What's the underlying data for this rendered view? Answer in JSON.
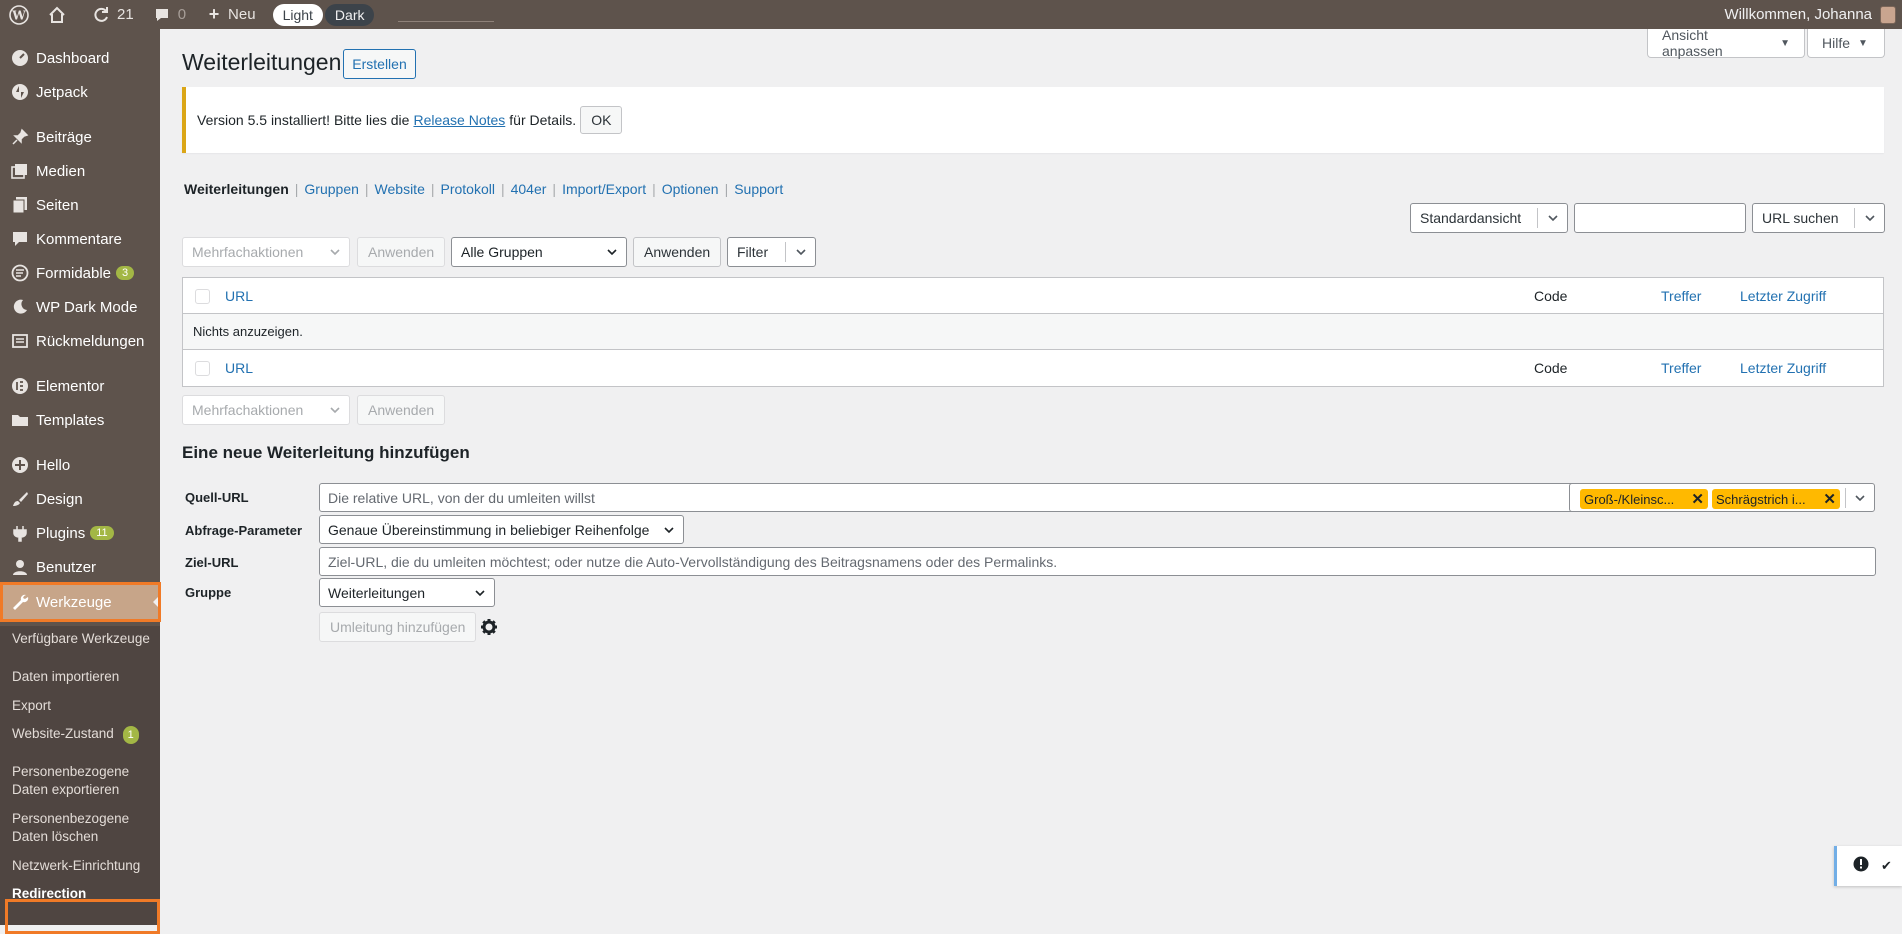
{
  "adminbar": {
    "updates_count": "21",
    "comments_count": "0",
    "new_label": "Neu",
    "mode_light": "Light",
    "mode_dark": "Dark",
    "greeting": "Willkommen, Johanna"
  },
  "sidebar": {
    "items": [
      {
        "label": "Dashboard",
        "icon": "dashboard-icon"
      },
      {
        "label": "Jetpack",
        "icon": "jetpack-icon"
      },
      {
        "label": "Beiträge",
        "icon": "pin-icon"
      },
      {
        "label": "Medien",
        "icon": "media-icon"
      },
      {
        "label": "Seiten",
        "icon": "pages-icon"
      },
      {
        "label": "Kommentare",
        "icon": "comment-icon"
      },
      {
        "label": "Formidable",
        "icon": "formidable-icon",
        "badge": "3"
      },
      {
        "label": "WP Dark Mode",
        "icon": "moon-icon"
      },
      {
        "label": "Rückmeldungen",
        "icon": "feedback-icon"
      },
      {
        "label": "Elementor",
        "icon": "elementor-icon"
      },
      {
        "label": "Templates",
        "icon": "folder-icon"
      },
      {
        "label": "Hello",
        "icon": "plus-circle-icon"
      },
      {
        "label": "Design",
        "icon": "brush-icon"
      },
      {
        "label": "Plugins",
        "icon": "plugin-icon",
        "badge": "11"
      },
      {
        "label": "Benutzer",
        "icon": "user-icon"
      },
      {
        "label": "Werkzeuge",
        "icon": "wrench-icon"
      }
    ],
    "submenu": [
      "Verfügbare Werkzeuge",
      "Daten importieren",
      "Export",
      "Website-Zustand",
      "Personenbezogene Daten exportieren",
      "Personenbezogene Daten löschen",
      "Netzwerk-Einrichtung",
      "Redirection"
    ],
    "website_badge": "1"
  },
  "header": {
    "screen_options": "Ansicht anpassen",
    "help": "Hilfe",
    "title": "Weiterleitungen",
    "create_button": "Erstellen"
  },
  "notice": {
    "text_before": "Version 5.5 installiert! Bitte lies die",
    "link": "Release Notes",
    "text_after": "für Details.",
    "ok": "OK"
  },
  "tabs": [
    "Weiterleitungen",
    "Gruppen",
    "Website",
    "Protokoll",
    "404er",
    "Import/Export",
    "Optionen",
    "Support"
  ],
  "controls": {
    "view_select": "Standardansicht",
    "search_value": "",
    "search_button": "URL suchen",
    "bulk_actions": "Mehrfachaktionen",
    "apply": "Anwenden",
    "groups_select": "Alle Gruppen",
    "apply2": "Anwenden",
    "filter": "Filter"
  },
  "table": {
    "columns": {
      "url": "URL",
      "code": "Code",
      "hits": "Treffer",
      "last": "Letzter Zugriff"
    },
    "empty": "Nichts anzuzeigen."
  },
  "add_form": {
    "title": "Eine neue Weiterleitung hinzufügen",
    "source_label": "Quell-URL",
    "source_placeholder": "Die relative URL, von der du umleiten willst",
    "flag1": "Groß-/Kleinsc...",
    "flag2": "Schrägstrich i...",
    "query_label": "Abfrage-Parameter",
    "query_value": "Genaue Übereinstimmung in beliebiger Reihenfolge",
    "target_label": "Ziel-URL",
    "target_placeholder": "Ziel-URL, die du umleiten möchtest; oder nutze die Auto-Vervollständigung des Beitragsnamens oder des Permalinks.",
    "group_label": "Gruppe",
    "group_value": "Weiterleitungen",
    "submit": "Umleitung hinzufügen"
  },
  "colors": {
    "admin_bg": "#5e534c",
    "current_menu": "#c7a589",
    "highlight": "#f07a27",
    "link": "#2271b1",
    "flag": "#ffb900"
  }
}
